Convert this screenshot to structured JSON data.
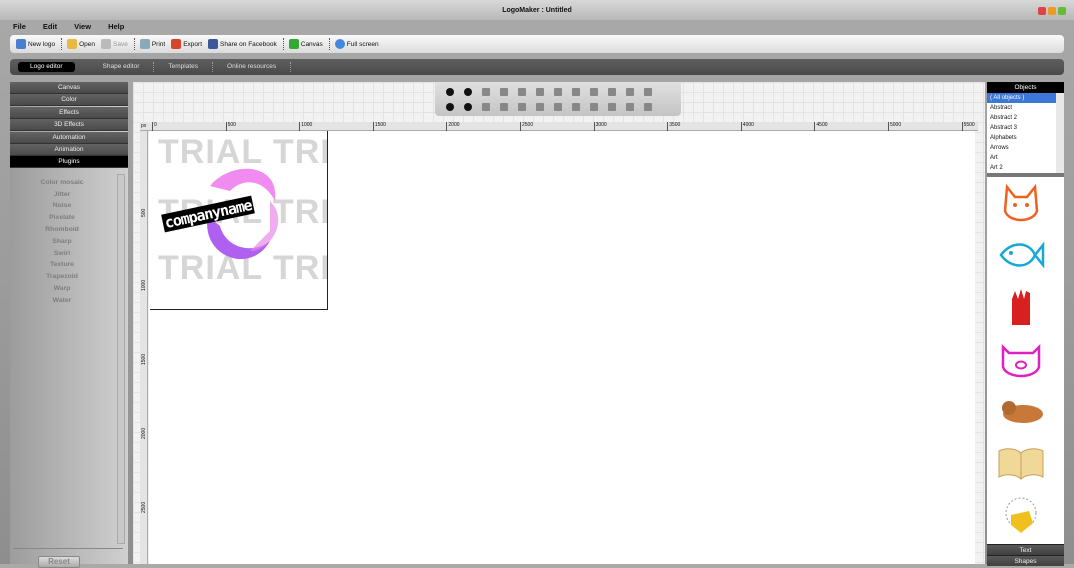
{
  "window": {
    "title": "LogoMaker : Untitled"
  },
  "menu": [
    "File",
    "Edit",
    "View",
    "Help"
  ],
  "toolbar": {
    "new_logo": "New logo",
    "open": "Open",
    "save": "Save",
    "print": "Print",
    "export": "Export",
    "share": "Share on Facebook",
    "canvas": "Canvas",
    "fullscreen": "Full screen"
  },
  "tabs": [
    "Logo editor",
    "Shape editor",
    "Templates",
    "Online resources"
  ],
  "left_panel": {
    "sections": [
      "Canvas",
      "Color",
      "Effects",
      "3D Effects",
      "Automation",
      "Animation",
      "Plugins"
    ],
    "plugins": [
      "Color mosaic",
      "Jitter",
      "Noise",
      "Pixelate",
      "Rhomboid",
      "Sharp",
      "Swirl",
      "Texture",
      "Trapezoid",
      "Warp",
      "Water"
    ],
    "reset": "Reset"
  },
  "ruler": {
    "unit": "px",
    "h_labels": [
      "0",
      "500",
      "1000",
      "1500",
      "2000",
      "2500",
      "3000",
      "3500",
      "4000",
      "4500",
      "5000",
      "5500"
    ],
    "v_labels": [
      "500",
      "1000",
      "1500",
      "2000",
      "2500"
    ]
  },
  "canvas": {
    "watermark": "TRIAL TRIAL",
    "logo_text": "companyname",
    "colors": {
      "pink": "#f08cf0",
      "purple": "#b060f0"
    }
  },
  "objects": {
    "title": "Objects",
    "items": [
      "( All objects )",
      "Abstract",
      "Abstract 2",
      "Abstract 3",
      "Alphabets",
      "Arrows",
      "Art",
      "Art 2"
    ],
    "gallery": [
      "cat-icon",
      "fish-icon",
      "hand-icon",
      "pig-icon",
      "bear-icon",
      "book-icon",
      "bird-icon"
    ],
    "tabs": [
      "Text",
      "Shapes"
    ]
  }
}
